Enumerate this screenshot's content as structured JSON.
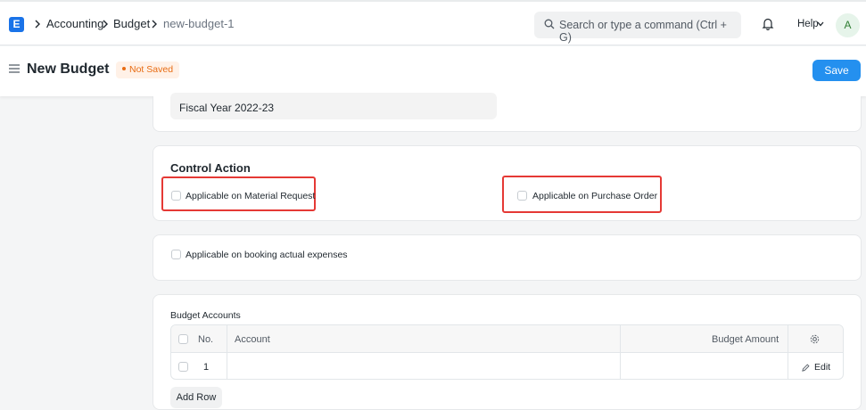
{
  "navbar": {
    "logo_letter": "E",
    "breadcrumbs": [
      "Accounting",
      "Budget",
      "new-budget-1"
    ],
    "search_placeholder": "Search or type a command (Ctrl + G)",
    "help_label": "Help",
    "avatar_letter": "A"
  },
  "page": {
    "title": "New Budget",
    "status": "Not Saved",
    "save_label": "Save"
  },
  "fiscal_year": {
    "value": "Fiscal Year 2022-23"
  },
  "control_action": {
    "title": "Control Action",
    "material_request_label": "Applicable on Material Request",
    "purchase_order_label": "Applicable on Purchase Order"
  },
  "booking": {
    "label": "Applicable on booking actual expenses"
  },
  "budget_accounts": {
    "title": "Budget Accounts",
    "columns": {
      "no": "No.",
      "account": "Account",
      "amount": "Budget Amount"
    },
    "rows": [
      {
        "no": "1",
        "account": "",
        "amount": "",
        "edit": "Edit"
      }
    ],
    "add_row_label": "Add Row"
  },
  "colors": {
    "primary": "#2490ef",
    "highlight": "#e53935",
    "status": "#e86c13"
  }
}
